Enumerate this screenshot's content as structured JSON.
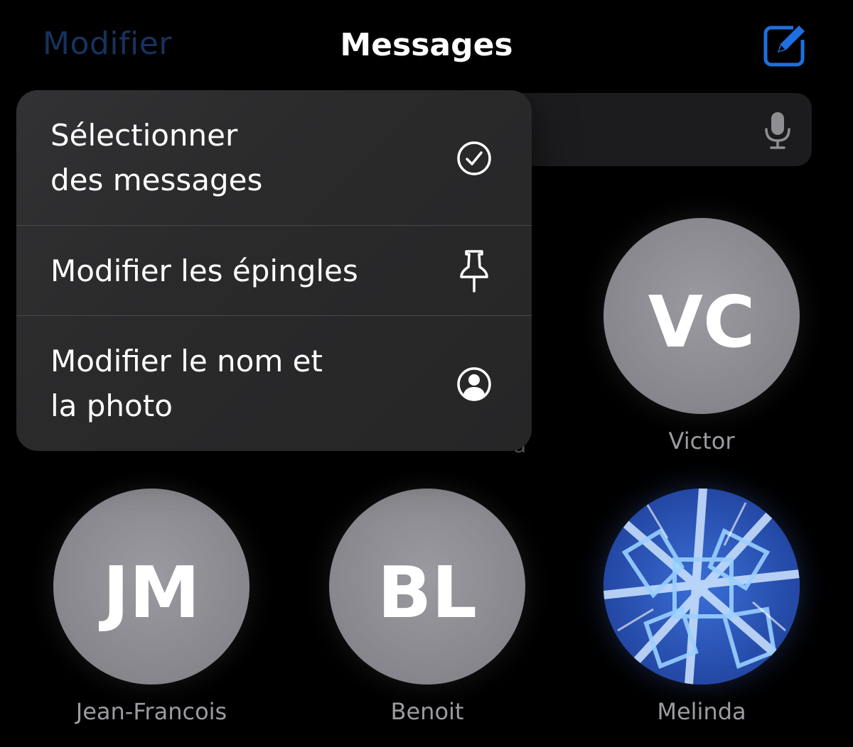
{
  "header": {
    "edit_label": "Modifier",
    "title": "Messages",
    "compose_icon": "compose-icon"
  },
  "search": {
    "mic_icon": "microphone-icon"
  },
  "menu": {
    "items": [
      {
        "label": "Sélectionner\ndes messages",
        "icon": "checkmark-circle-icon"
      },
      {
        "label": "Modifier les épingles",
        "icon": "pin-icon"
      },
      {
        "label": "Modifier le nom et\nla photo",
        "icon": "person-circle-icon"
      }
    ]
  },
  "pinned": [
    {
      "name": "Victor",
      "initials": "VC"
    },
    {
      "name": "Jean-Francois",
      "initials": "JM"
    },
    {
      "name": "Benoit",
      "initials": "BL"
    },
    {
      "name": "Melinda",
      "initials": ""
    }
  ],
  "partial_text": "a",
  "colors": {
    "accent": "#1f6fe0",
    "edit_dimmed": "#16335e",
    "avatar_gray": "#8e8e93",
    "menu_bg": "#2a2a2c"
  }
}
